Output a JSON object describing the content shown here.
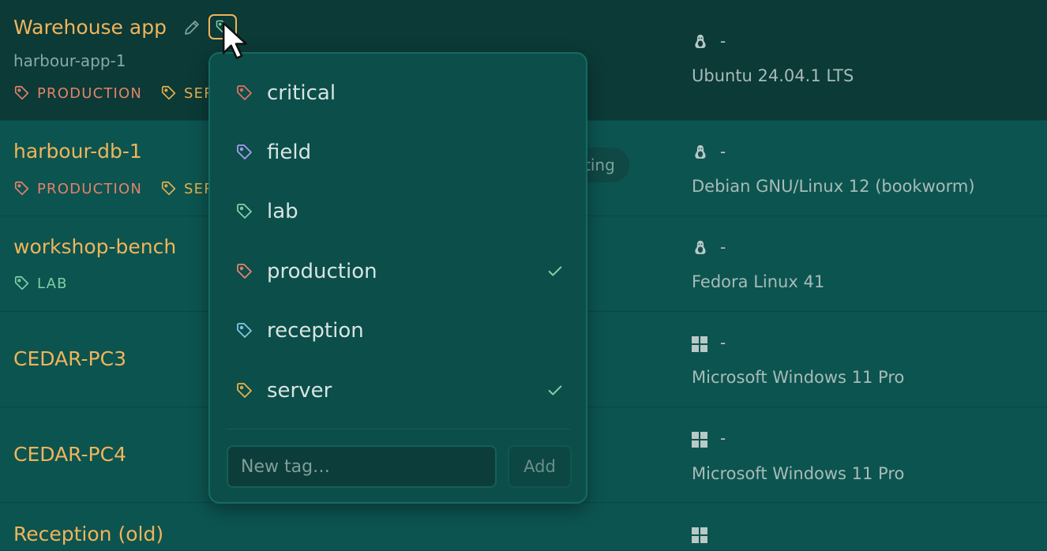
{
  "colors": {
    "accent": "#f1b45a",
    "tag_production": "#e4826a",
    "tag_server": "#e8b04e",
    "tag_lab": "#7fd0a6",
    "tag_critical": "#e07062",
    "tag_field": "#a99cf0",
    "tag_reception": "#7ec8e6",
    "check": "#7fd0a6"
  },
  "rows": [
    {
      "name": "Warehouse app",
      "hostname": "harbour-app-1",
      "tags": [
        "PRODUCTION",
        "SER"
      ],
      "os_icon": "linux-penguin-icon",
      "os_dash": "-",
      "os_name": "Ubuntu 24.04.1 LTS"
    },
    {
      "name": "harbour-db-1",
      "tags": [
        "PRODUCTION",
        "SER"
      ],
      "status": "ting",
      "os_icon": "linux-penguin-icon",
      "os_dash": "-",
      "os_name": "Debian GNU/Linux 12 (bookworm)"
    },
    {
      "name": "workshop-bench",
      "tags": [
        "LAB"
      ],
      "os_icon": "linux-penguin-icon",
      "os_dash": "-",
      "os_name": "Fedora Linux 41"
    },
    {
      "name": "CEDAR-PC3",
      "os_icon": "windows-icon",
      "os_dash": "-",
      "os_name": "Microsoft Windows 11 Pro"
    },
    {
      "name": "CEDAR-PC4",
      "os_icon": "windows-icon",
      "os_dash": "-",
      "os_name": "Microsoft Windows 11 Pro"
    },
    {
      "name": "Reception (old)",
      "os_icon": "windows-icon"
    }
  ],
  "tag_menu": {
    "options": [
      {
        "label": "critical",
        "checked": false
      },
      {
        "label": "field",
        "checked": false
      },
      {
        "label": "lab",
        "checked": false
      },
      {
        "label": "production",
        "checked": true
      },
      {
        "label": "reception",
        "checked": false
      },
      {
        "label": "server",
        "checked": true
      }
    ],
    "new_tag_placeholder": "New tag…",
    "add_label": "Add"
  }
}
